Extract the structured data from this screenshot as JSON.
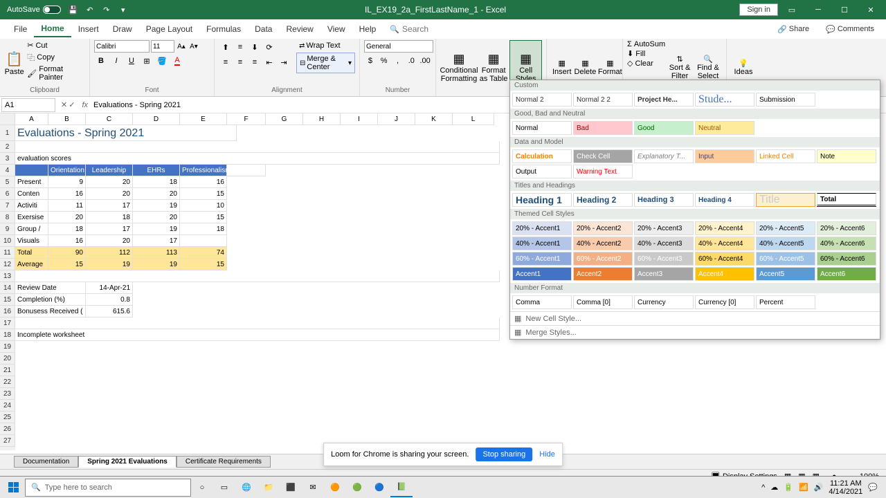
{
  "title": "IL_EX19_2a_FirstLastName_1 - Excel",
  "autosave": "AutoSave",
  "signin": "Sign in",
  "tabs": {
    "file": "File",
    "home": "Home",
    "insert": "Insert",
    "draw": "Draw",
    "pagelayout": "Page Layout",
    "formulas": "Formulas",
    "data": "Data",
    "review": "Review",
    "view": "View",
    "help": "Help"
  },
  "search_placeholder": "Search",
  "share": "Share",
  "comments": "Comments",
  "clipboard": {
    "label": "Clipboard",
    "paste": "Paste",
    "cut": "Cut",
    "copy": "Copy",
    "fp": "Format Painter"
  },
  "font": {
    "label": "Font",
    "name": "Calibri",
    "size": "11"
  },
  "alignment": {
    "label": "Alignment",
    "wrap": "Wrap Text",
    "merge": "Merge & Center"
  },
  "number": {
    "label": "Number",
    "format": "General"
  },
  "styles": {
    "cf": "Conditional Formatting",
    "fat": "Format as Table",
    "cs": "Cell Styles"
  },
  "cells_grp": {
    "insert": "Insert",
    "delete": "Delete",
    "format": "Format"
  },
  "editing": {
    "autosum": "AutoSum",
    "fill": "Fill",
    "clear": "Clear",
    "sort": "Sort & Filter",
    "find": "Find & Select"
  },
  "ideas": "Ideas",
  "namebox": "A1",
  "formula": "Evaluations - Spring 2021",
  "cols": [
    "A",
    "B",
    "C",
    "D",
    "E",
    "F",
    "G",
    "H",
    "I",
    "J",
    "K",
    "L"
  ],
  "data": {
    "title": "Evaluations - Spring 2021",
    "r3": "evaluation scores",
    "h": [
      "Orientation",
      "Leadership",
      "EHRs",
      "Professionalism"
    ],
    "rows": [
      {
        "l": "Present",
        "v": [
          "9",
          "20",
          "18",
          "16"
        ]
      },
      {
        "l": "Conten",
        "v": [
          "16",
          "20",
          "20",
          "15"
        ]
      },
      {
        "l": "Activiti",
        "v": [
          "11",
          "17",
          "19",
          "10"
        ]
      },
      {
        "l": "Exersise",
        "v": [
          "20",
          "18",
          "20",
          "15"
        ]
      },
      {
        "l": "Group /",
        "v": [
          "18",
          "17",
          "19",
          "18"
        ]
      },
      {
        "l": "Visuals",
        "v": [
          "16",
          "20",
          "17",
          ""
        ]
      }
    ],
    "total": {
      "l": "Total",
      "v": [
        "90",
        "112",
        "113",
        "74"
      ]
    },
    "avg": {
      "l": "Average",
      "v": [
        "15",
        "19",
        "19",
        "15"
      ]
    },
    "review": {
      "l": "Review Date",
      "v": "14-Apr-21"
    },
    "completion": {
      "l": "Completion (%)",
      "v": "0.8"
    },
    "bonus": {
      "l": "Bonusess Received (",
      "v": "615.6"
    },
    "incomplete": "Incomplete worksheet"
  },
  "sp": {
    "custom": "Custom",
    "normal2": "Normal 2",
    "normal22": "Normal 2 2",
    "projhe": "Project He...",
    "stude": "Stude...",
    "submission": "Submission",
    "gbn": "Good, Bad and Neutral",
    "normal": "Normal",
    "bad": "Bad",
    "good": "Good",
    "neutral": "Neutral",
    "dam": "Data and Model",
    "calc": "Calculation",
    "check": "Check Cell",
    "explan": "Explanatory T...",
    "input": "Input",
    "linked": "Linked Cell",
    "note": "Note",
    "output": "Output",
    "warn": "Warning Text",
    "th": "Titles and Headings",
    "h1": "Heading 1",
    "h2": "Heading 2",
    "h3": "Heading 3",
    "h4": "Heading 4",
    "titlec": "Title",
    "totalc": "Total",
    "tcs": "Themed Cell Styles",
    "a20": [
      "20% - Accent1",
      "20% - Accent2",
      "20% - Accent3",
      "20% - Accent4",
      "20% - Accent5",
      "20% - Accent6"
    ],
    "a40": [
      "40% - Accent1",
      "40% - Accent2",
      "40% - Accent3",
      "40% - Accent4",
      "40% - Accent5",
      "40% - Accent6"
    ],
    "a60": [
      "60% - Accent1",
      "60% - Accent2",
      "60% - Accent3",
      "60% - Accent4",
      "60% - Accent5",
      "60% - Accent6"
    ],
    "acc": [
      "Accent1",
      "Accent2",
      "Accent3",
      "Accent4",
      "Accent5",
      "Accent6"
    ],
    "nf": "Number Format",
    "comma": "Comma",
    "comma0": "Comma [0]",
    "currency": "Currency",
    "currency0": "Currency [0]",
    "percent": "Percent",
    "newcs": "New Cell Style...",
    "merges": "Merge Styles..."
  },
  "sheets": {
    "doc": "Documentation",
    "eval": "Spring 2021 Evaluations",
    "cert": "Certificate Requirements"
  },
  "notif": {
    "msg": "Loom for Chrome is sharing your screen.",
    "stop": "Stop sharing",
    "hide": "Hide"
  },
  "status": {
    "ds": "Display Settings",
    "zoom": "100%"
  },
  "taskbar": {
    "search": "Type here to search",
    "time": "11:21 AM",
    "date": "4/14/2021"
  }
}
